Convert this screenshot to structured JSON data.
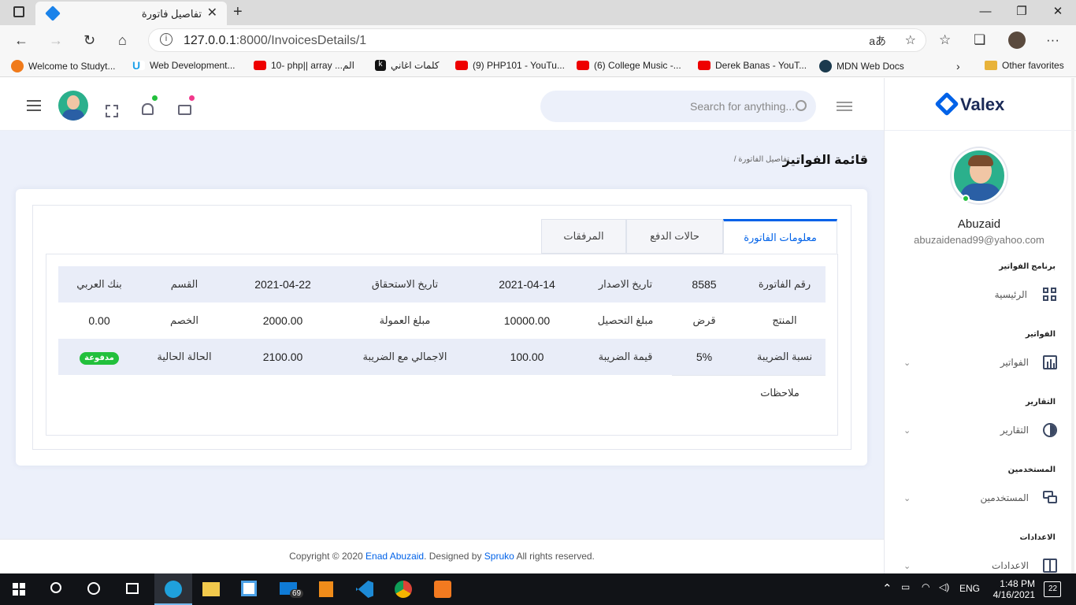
{
  "browser": {
    "tab_title": "تفاصيل فاتورة",
    "url_host": "127.0.0.1",
    "url_path": ":8000/InvoicesDetails/1",
    "bookmarks": [
      "Welcome to Studyt...",
      "Web Development...",
      "10- php|| array ...الم",
      "كلمات اغاني",
      "(9) PHP101 - YouTu...",
      "(6) College Music -...",
      "Derek Banas - YouT...",
      "MDN Web Docs"
    ],
    "other_favorites": "Other favorites"
  },
  "header": {
    "search_placeholder": "Search for anything..."
  },
  "page": {
    "title": "قائمة الفواتير",
    "breadcrumb": "/ تفاصيل الفاتورة"
  },
  "tabs": [
    "معلومات الفاتورة",
    "حالات الدفع",
    "المرفقات"
  ],
  "invoice": {
    "row1": [
      "رقم الفاتورة",
      "8585",
      "تاريخ الاصدار",
      "2021-04-14",
      "تاريخ الاستحقاق",
      "2021-04-22",
      "القسم",
      "بنك العربي"
    ],
    "row2": [
      "المنتج",
      "قرض",
      "مبلغ التحصيل",
      "10000.00",
      "مبلغ العمولة",
      "2000.00",
      "الخصم",
      "0.00"
    ],
    "row3": [
      "نسبة الضريبة",
      "5%",
      "قيمة الضريبة",
      "100.00",
      "الاجمالي مع الضريبة",
      "2100.00",
      "الحالة الحالية",
      "مدفوعة"
    ],
    "notes_label": "ملاحظات"
  },
  "footer": {
    "pre": "Copyright © 2020 ",
    "author": "Enad Abuzaid",
    "mid": ". Designed by ",
    "designer": "Spruko",
    "post": " All rights reserved."
  },
  "sidebar": {
    "brand": "Valex",
    "user_name": "Abuzaid",
    "user_email": "abuzaidenad99@yahoo.com",
    "sections": [
      {
        "heading": "برنامج الفواتير",
        "item": "الرئيسية"
      },
      {
        "heading": "الفواتير",
        "item": "الفواتير"
      },
      {
        "heading": "التقارير",
        "item": "التقارير"
      },
      {
        "heading": "المستخدمين",
        "item": "المستخدمين"
      },
      {
        "heading": "الاعدادات",
        "item": "الاعدادات"
      }
    ]
  },
  "taskbar": {
    "mail_badge": "69",
    "lang": "ENG",
    "time": "1:48 PM",
    "date": "4/16/2021",
    "notif_count": "22"
  },
  "colors": {
    "accent": "#0162e8",
    "paid": "#22c03c",
    "bg": "#ecf0fa"
  }
}
